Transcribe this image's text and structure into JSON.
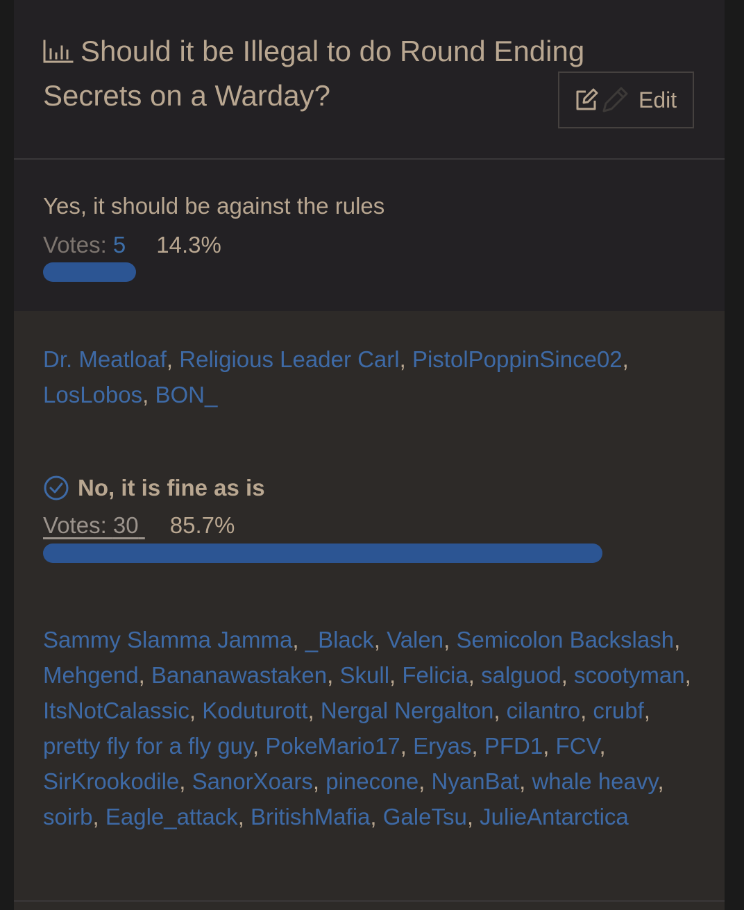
{
  "poll": {
    "title": "Should it be Illegal to do Round Ending Secrets on a Warday?",
    "edit_label": "Edit",
    "options": [
      {
        "label": "Yes, it should be against the rules",
        "votes_label": "Votes: ",
        "votes": "5",
        "percent": "14.3%",
        "fraction": 0.143,
        "selected": false,
        "voters": [
          "Dr. Meatloaf",
          "Religious Leader Carl",
          "PistolPoppinSince02",
          "LosLobos",
          "BON_"
        ]
      },
      {
        "label": "No, it is fine as is",
        "votes_label": "Votes: ",
        "votes": "30",
        "percent": "85.7%",
        "fraction": 0.857,
        "selected": true,
        "voters": [
          "Sammy Slamma Jamma",
          "_Black",
          "Valen",
          "Semicolon Backslash",
          "Mehgend",
          "Bananawastaken",
          "Skull",
          "Felicia",
          "salguod",
          "scootyman",
          "ItsNotCalassic",
          "Koduturott",
          "Nergal Nergalton",
          "cilantro",
          "crubf",
          "pretty fly for a fly guy",
          "PokeMario17",
          "Eryas",
          "PFD1",
          "FCV",
          "SirKrookodile",
          "SanorXoars",
          "pinecone",
          "NyanBat",
          "whale heavy",
          "soirb",
          "Eagle_attack",
          "BritishMafia",
          "GaleTsu",
          "JulieAntarctica"
        ]
      }
    ]
  },
  "colors": {
    "bar": "#2c5593",
    "link": "#3e6aa6",
    "text": "#b9a791"
  }
}
